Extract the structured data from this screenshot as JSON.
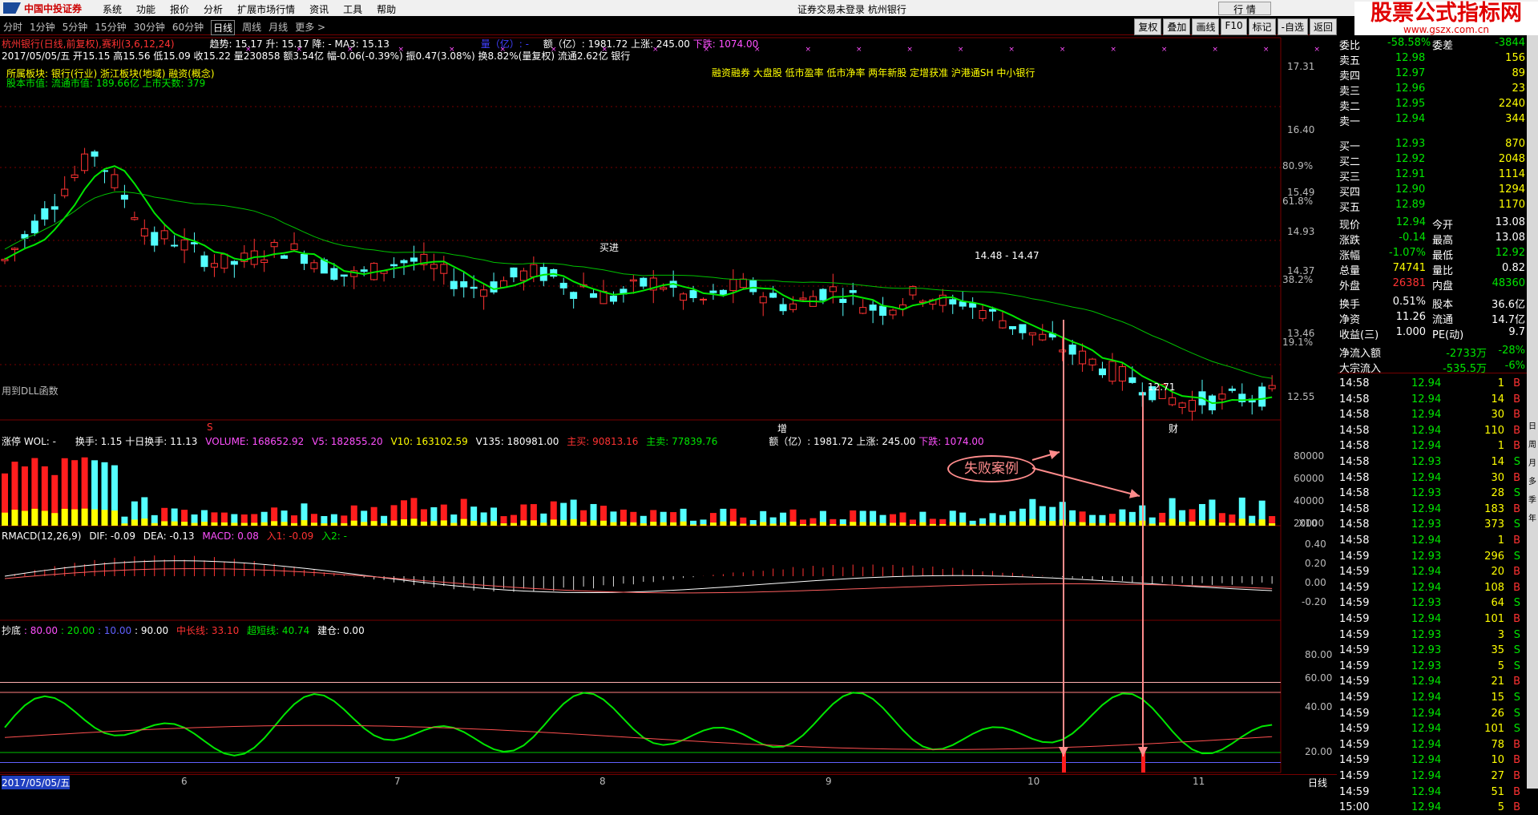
{
  "menubar": {
    "logo_text": "中国中投证券",
    "menus": [
      "系统",
      "功能",
      "报价",
      "分析",
      "扩展市场行情",
      "资讯",
      "工具",
      "帮助"
    ],
    "center_text": "证券交易未登录  杭州银行",
    "hq_button": "行 情"
  },
  "brand": {
    "title": "股票公式指标网",
    "url": "www.gszx.com.cn"
  },
  "timeframes": [
    "分时",
    "1分钟",
    "5分钟",
    "15分钟",
    "30分钟",
    "60分钟",
    "日线",
    "周线",
    "月线",
    "更多 >"
  ],
  "active_timeframe": "日线",
  "right_buttons": [
    "复权",
    "叠加",
    "画线",
    "F10",
    "标记",
    "-自选",
    "返回"
  ],
  "chart_header": {
    "stock": "杭州银行(日线,前复权),赛利(3,6,12,24)",
    "ma_text": "趋势: 15.17  升: 15.17  降: -  MA3: 15.13",
    "volume_ratio": "量（亿）: -",
    "amount": "额（亿）: 1981.72",
    "up": "上涨: 245.00",
    "down": "下跌: 1074.00",
    "info_line": "2017/05/05/五 开15.15 高15.56 低15.09 收15.22 量230858 额3.54亿 幅-0.06(-0.39%) 振0.47(3.08%) 换8.82%(量复权) 流通2.62亿 银行",
    "sector_line": "所属板块: 银行(行业) 浙江板块(地域) 融资(概念)",
    "market_line": "股本市值: 流通市值: 189.66亿 上市天数: 379",
    "concept_tags": "融资融券 大盘股 低市盈率 低市净率 两年新股 定增获准 沪港通SH 中小银行",
    "dll_note": "用到DLL函数"
  },
  "price_axis": [
    "17.31",
    "16.40",
    "15.49",
    "14.93",
    "14.37",
    "13.46",
    "12.55"
  ],
  "pct_axis": [
    "80.9%",
    "61.8%",
    "38.2%",
    "19.1%"
  ],
  "chart_annotations": {
    "buy_label": "买进",
    "level_label": "14.48 - 14.47",
    "low_label": "12.71",
    "marker_s": "S",
    "marker_zeng": "增",
    "marker_cai": "财"
  },
  "volume_header": {
    "name": "涨停 WOL: -",
    "turnover": "换手: 1.15  十日换手: 11.13",
    "volume": "VOLUME: 168652.92",
    "v5": "V5: 182855.20",
    "v10": "V10: 163102.59",
    "v135": "V135: 180981.00",
    "buy": "主买: 90813.16",
    "sell": "主卖: 77839.76",
    "amount2": "额（亿）: 1981.72",
    "up2": "上涨: 245.00",
    "down2": "下跌: 1074.00"
  },
  "volume_axis": [
    "80000",
    "60000",
    "40000",
    "20000"
  ],
  "volume_unit": "X10",
  "macd_header": {
    "name": "RMACD(12,26,9)",
    "dif": "DIF: -0.09",
    "dea": "DEA: -0.13",
    "macd": "MACD: 0.08",
    "in1": "入1: -0.09",
    "in2": "入2: -"
  },
  "macd_axis": [
    "0.40",
    "0.20",
    "0.00",
    "-0.20"
  ],
  "bottom_header": {
    "name": "抄底",
    "l80": ": 80.00",
    "l20": ": 20.00",
    "l10": ": 10.00",
    "l90": ": 90.00",
    "mid": "中长线: 33.10",
    "short": "超短线: 40.74",
    "build": "建仓: 0.00"
  },
  "bottom_axis": [
    "80.00",
    "60.00",
    "40.00",
    "20.00"
  ],
  "date_axis": {
    "start": "2017/05/05/五",
    "months": [
      "6",
      "7",
      "8",
      "9",
      "10",
      "11"
    ],
    "period": "日线"
  },
  "annotation": {
    "label": "失败案例"
  },
  "quote": {
    "header_row": {
      "label": "委比",
      "val": "-58.58%",
      "label2": "委差",
      "val2": "-3844"
    },
    "asks": [
      {
        "label": "卖五",
        "price": "12.98",
        "vol": "156"
      },
      {
        "label": "卖四",
        "price": "12.97",
        "vol": "89"
      },
      {
        "label": "卖三",
        "price": "12.96",
        "vol": "23"
      },
      {
        "label": "卖二",
        "price": "12.95",
        "vol": "2240"
      },
      {
        "label": "卖一",
        "price": "12.94",
        "vol": "344"
      }
    ],
    "bids": [
      {
        "label": "买一",
        "price": "12.93",
        "vol": "870"
      },
      {
        "label": "买二",
        "price": "12.92",
        "vol": "2048"
      },
      {
        "label": "买三",
        "price": "12.91",
        "vol": "1114"
      },
      {
        "label": "买四",
        "price": "12.90",
        "vol": "1294"
      },
      {
        "label": "买五",
        "price": "12.89",
        "vol": "1170"
      }
    ],
    "stats": [
      {
        "l1": "现价",
        "v1": "12.94",
        "l2": "今开",
        "v2": "13.08",
        "c1": "green",
        "c2": "white"
      },
      {
        "l1": "涨跌",
        "v1": "-0.14",
        "l2": "最高",
        "v2": "13.08",
        "c1": "green",
        "c2": "white"
      },
      {
        "l1": "涨幅",
        "v1": "-1.07%",
        "l2": "最低",
        "v2": "12.92",
        "c1": "green",
        "c2": "green"
      },
      {
        "l1": "总量",
        "v1": "74741",
        "l2": "量比",
        "v2": "0.82",
        "c1": "yellow",
        "c2": "white"
      },
      {
        "l1": "外盘",
        "v1": "26381",
        "l2": "内盘",
        "v2": "48360",
        "c1": "red",
        "c2": "green"
      },
      {
        "l1": "换手",
        "v1": "0.51%",
        "l2": "股本",
        "v2": "36.6亿",
        "c1": "white",
        "c2": "white"
      },
      {
        "l1": "净资",
        "v1": "11.26",
        "l2": "流通",
        "v2": "14.7亿",
        "c1": "white",
        "c2": "white"
      },
      {
        "l1": "收益(三)",
        "v1": "1.000",
        "l2": "PE(动)",
        "v2": "9.7",
        "c1": "white",
        "c2": "white"
      }
    ],
    "flows": [
      {
        "label": "净流入额",
        "val": "-2733万",
        "pct": "-28%"
      },
      {
        "label": "大宗流入",
        "val": "-535.5万",
        "pct": "-6%"
      }
    ],
    "ticks": [
      {
        "t": "14:58",
        "p": "12.94",
        "v": "1",
        "d": "B"
      },
      {
        "t": "14:58",
        "p": "12.94",
        "v": "14",
        "d": "B"
      },
      {
        "t": "14:58",
        "p": "12.94",
        "v": "30",
        "d": "B"
      },
      {
        "t": "14:58",
        "p": "12.94",
        "v": "110",
        "d": "B"
      },
      {
        "t": "14:58",
        "p": "12.94",
        "v": "1",
        "d": "B"
      },
      {
        "t": "14:58",
        "p": "12.93",
        "v": "14",
        "d": "S"
      },
      {
        "t": "14:58",
        "p": "12.94",
        "v": "30",
        "d": "B"
      },
      {
        "t": "14:58",
        "p": "12.93",
        "v": "28",
        "d": "S"
      },
      {
        "t": "14:58",
        "p": "12.94",
        "v": "183",
        "d": "B"
      },
      {
        "t": "14:58",
        "p": "12.93",
        "v": "373",
        "d": "S"
      },
      {
        "t": "14:58",
        "p": "12.94",
        "v": "1",
        "d": "B"
      },
      {
        "t": "14:59",
        "p": "12.93",
        "v": "296",
        "d": "S"
      },
      {
        "t": "14:59",
        "p": "12.94",
        "v": "20",
        "d": "B"
      },
      {
        "t": "14:59",
        "p": "12.94",
        "v": "108",
        "d": "B"
      },
      {
        "t": "14:59",
        "p": "12.93",
        "v": "64",
        "d": "S"
      },
      {
        "t": "14:59",
        "p": "12.94",
        "v": "101",
        "d": "B"
      },
      {
        "t": "14:59",
        "p": "12.93",
        "v": "3",
        "d": "S"
      },
      {
        "t": "14:59",
        "p": "12.93",
        "v": "35",
        "d": "S"
      },
      {
        "t": "14:59",
        "p": "12.93",
        "v": "5",
        "d": "S"
      },
      {
        "t": "14:59",
        "p": "12.94",
        "v": "21",
        "d": "B"
      },
      {
        "t": "14:59",
        "p": "12.94",
        "v": "15",
        "d": "S"
      },
      {
        "t": "14:59",
        "p": "12.94",
        "v": "26",
        "d": "S"
      },
      {
        "t": "14:59",
        "p": "12.94",
        "v": "101",
        "d": "S"
      },
      {
        "t": "14:59",
        "p": "12.94",
        "v": "78",
        "d": "B"
      },
      {
        "t": "14:59",
        "p": "12.94",
        "v": "10",
        "d": "B"
      },
      {
        "t": "14:59",
        "p": "12.94",
        "v": "27",
        "d": "B"
      },
      {
        "t": "14:59",
        "p": "12.94",
        "v": "51",
        "d": "B"
      },
      {
        "t": "15:00",
        "p": "12.94",
        "v": "5",
        "d": "B"
      }
    ]
  },
  "toolstrip": [
    "日",
    "周",
    "月",
    "多",
    "季",
    "年"
  ],
  "colors": {
    "up": "#ff3232",
    "down": "#54ffff",
    "ma_green": "#00e600",
    "bg": "#000000",
    "grid": "#700000"
  }
}
